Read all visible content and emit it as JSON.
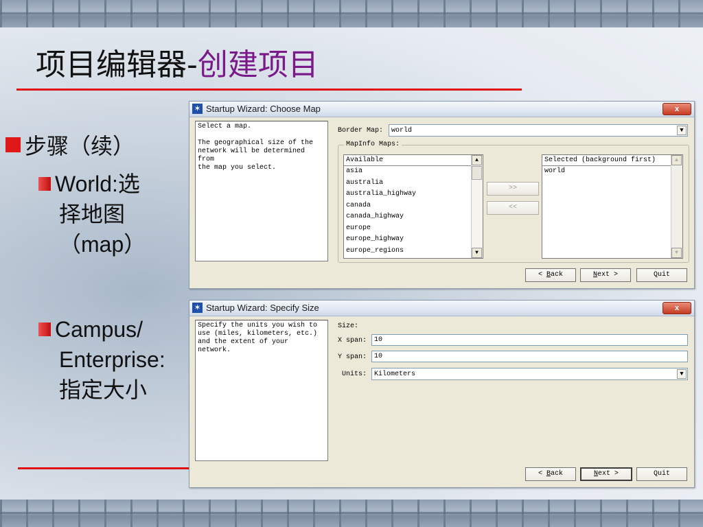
{
  "slide": {
    "title_main": "项目编辑器-",
    "title_accent": "创建项目",
    "bullet1": "步骤（续）",
    "sub1_line1": "World:选",
    "sub1_line2": "择地图",
    "sub1_line3": "（map）",
    "sub2_line1": "Campus/",
    "sub2_line2": "Enterprise:",
    "sub2_line3": "指定大小"
  },
  "colors": {
    "accent": "#7a1a8a",
    "rule": "#e01010"
  },
  "window1": {
    "title": "Startup Wizard: Choose Map",
    "close_label": "x",
    "description": [
      "Select a map.",
      "",
      "The geographical size of the",
      "network will be determined from",
      "the map you select."
    ],
    "border_map_label": "Border Map:",
    "border_map_value": "world",
    "mapinfo_legend": "MapInfo Maps:",
    "available_header": "Available",
    "available_items": [
      "asia",
      "australia",
      "australia_highway",
      "canada",
      "canada_highway",
      "europe",
      "europe_highway",
      "europe_regions"
    ],
    "add_button": ">>",
    "remove_button": "<<",
    "selected_header": "Selected (background first)",
    "selected_items": [
      "world"
    ],
    "back_prefix": "< ",
    "back_hot": "B",
    "back_rest": "ack",
    "next_hot": "N",
    "next_rest": "ext",
    "next_suffix": " >",
    "quit_label": "Quit"
  },
  "window2": {
    "title": "Startup Wizard: Specify Size",
    "close_label": "x",
    "description": [
      "Specify the units you wish to",
      "use (miles, kilometers, etc.)",
      "and  the extent of your network."
    ],
    "size_label": "Size:",
    "xspan_label": "X span:",
    "xspan_value": "10",
    "yspan_label": "Y span:",
    "yspan_value": "10",
    "units_label": "Units:",
    "units_value": "Kilometers",
    "back_prefix": "< ",
    "back_hot": "B",
    "back_rest": "ack",
    "next_hot": "N",
    "next_rest": "ext",
    "next_suffix": " >",
    "quit_label": "Quit"
  }
}
